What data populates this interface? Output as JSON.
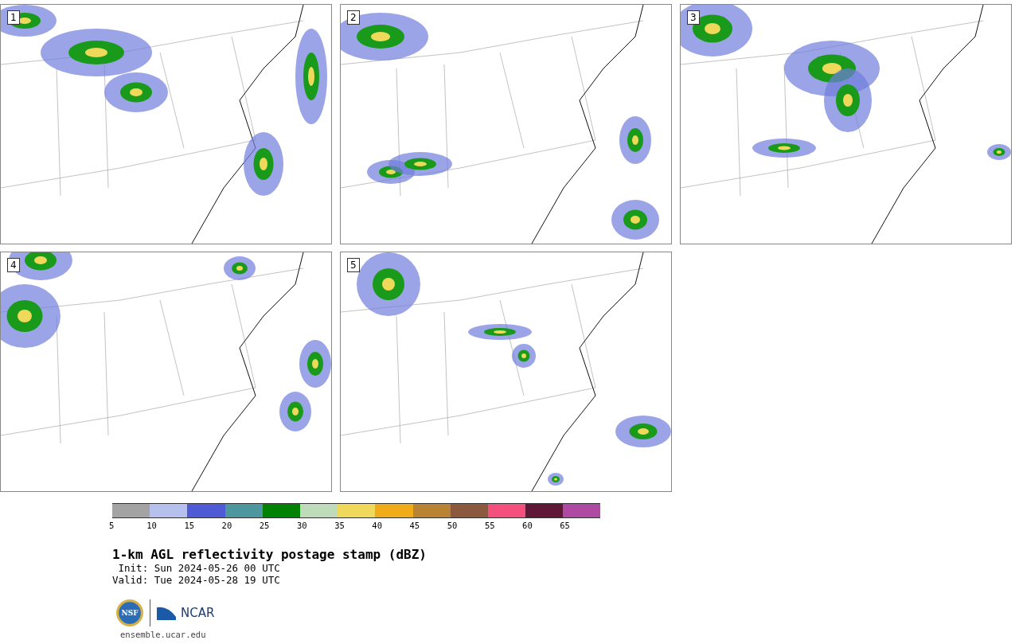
{
  "panels": [
    {
      "label": "1",
      "kind": "picture"
    },
    {
      "label": "2",
      "kind": "picture"
    },
    {
      "label": "3",
      "kind": "picture"
    },
    {
      "label": "4",
      "kind": "picture"
    },
    {
      "label": "5",
      "kind": "picture"
    }
  ],
  "colorbar": {
    "segments": [
      {
        "color": "#a3a3a3",
        "tick": "5"
      },
      {
        "color": "#b6c0ec",
        "tick": "10"
      },
      {
        "color": "#4f5bd5",
        "tick": "15"
      },
      {
        "color": "#4f979e",
        "tick": "20"
      },
      {
        "color": "#028202",
        "tick": "25"
      },
      {
        "color": "#bedcba",
        "tick": "30"
      },
      {
        "color": "#eed95a",
        "tick": "35"
      },
      {
        "color": "#efab18",
        "tick": "40"
      },
      {
        "color": "#ba8233",
        "tick": "45"
      },
      {
        "color": "#8b5a3e",
        "tick": "50"
      },
      {
        "color": "#f4507e",
        "tick": "55"
      },
      {
        "color": "#5f1836",
        "tick": "60"
      },
      {
        "color": "#ae4aa1",
        "tick": "65"
      }
    ]
  },
  "title": "1-km AGL reflectivity postage stamp (dBZ)",
  "init": " Init: Sun 2024-05-26 00 UTC",
  "valid": "Valid: Tue 2024-05-28 19 UTC",
  "logo": {
    "seal": "NSF",
    "name": "NCAR"
  },
  "url": "ensemble.ucar.edu"
}
